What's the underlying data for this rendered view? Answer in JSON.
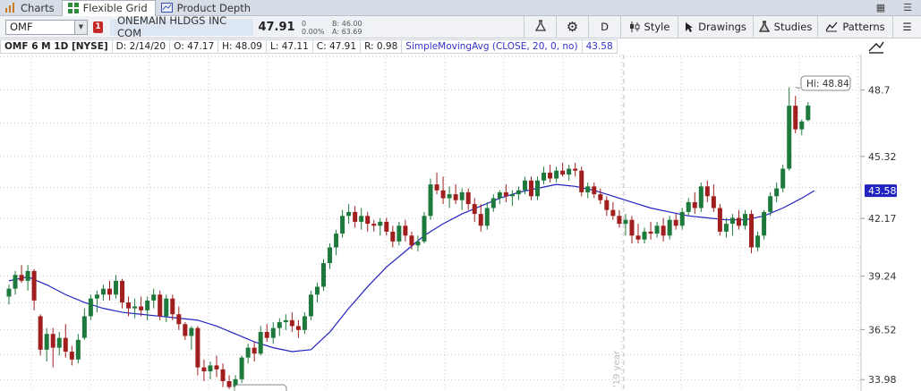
{
  "tabs": [
    {
      "label": "Charts",
      "icon": "bar-chart-icon",
      "active": false
    },
    {
      "label": "Flexible Grid",
      "icon": "grid-icon",
      "active": true
    },
    {
      "label": "Product Depth",
      "icon": "depth-icon",
      "active": false
    }
  ],
  "toolbar": {
    "symbol": "OMF",
    "badge": "1",
    "company": "ONEMAIN HLDGS INC COM",
    "last": "47.91",
    "change": "0",
    "change_pct": "0.00%",
    "bid": "B: 46.00",
    "ask": "A: 63.69",
    "aggregation": "D",
    "style_label": "Style",
    "drawings_label": "Drawings",
    "studies_label": "Studies",
    "patterns_label": "Patterns"
  },
  "info": {
    "title": "OMF 6 M 1D [NYSE]",
    "date": "D: 2/14/20",
    "open": "O: 47.17",
    "high": "H: 48.09",
    "low": "L: 47.11",
    "close": "C: 47.91",
    "range": "R: 0.98",
    "study": "SimpleMovingAvg (CLOSE, 20, 0, no)",
    "study_value": "43.58"
  },
  "chart_data": {
    "type": "candlestick",
    "y_ticks": [
      33.98,
      36.52,
      39.24,
      42.17,
      45.32,
      48.7
    ],
    "ylim": [
      33.4,
      50.5
    ],
    "hi_label": "Hi: 48.84",
    "study_value_label": "43.58",
    "year_label": "'19 year",
    "up_color": "#1e7a3c",
    "down_color": "#a01e1e",
    "sma_color": "#2323c0",
    "candles": [
      [
        38.2,
        38.8,
        37.8,
        38.6
      ],
      [
        38.6,
        39.5,
        38.3,
        39.3
      ],
      [
        39.3,
        39.8,
        38.9,
        39.0
      ],
      [
        39.0,
        39.8,
        38.5,
        39.5
      ],
      [
        39.5,
        39.6,
        37.5,
        38.0
      ],
      [
        37.2,
        37.3,
        35.2,
        35.5
      ],
      [
        35.5,
        36.6,
        34.9,
        36.3
      ],
      [
        36.3,
        36.6,
        34.6,
        35.6
      ],
      [
        35.6,
        36.4,
        35.2,
        36.1
      ],
      [
        36.1,
        36.8,
        35.1,
        35.4
      ],
      [
        35.4,
        35.7,
        34.7,
        35.0
      ],
      [
        35.0,
        36.3,
        34.8,
        36.0
      ],
      [
        36.1,
        37.6,
        36.0,
        37.2
      ],
      [
        37.2,
        38.3,
        37.0,
        38.1
      ],
      [
        38.1,
        38.5,
        37.4,
        38.3
      ],
      [
        38.3,
        38.8,
        38.0,
        38.6
      ],
      [
        38.6,
        39.0,
        38.0,
        38.3
      ],
      [
        38.3,
        39.3,
        38.1,
        39.0
      ],
      [
        39.0,
        39.1,
        37.6,
        37.9
      ],
      [
        37.9,
        38.2,
        37.2,
        37.6
      ],
      [
        37.6,
        38.1,
        37.1,
        37.7
      ],
      [
        37.7,
        38.2,
        37.2,
        37.5
      ],
      [
        37.5,
        38.2,
        37.0,
        38.0
      ],
      [
        38.0,
        38.6,
        37.6,
        38.3
      ],
      [
        38.3,
        38.5,
        37.0,
        37.2
      ],
      [
        37.2,
        38.3,
        36.9,
        38.1
      ],
      [
        38.1,
        38.3,
        37.0,
        37.3
      ],
      [
        37.3,
        37.7,
        36.5,
        36.8
      ],
      [
        36.8,
        36.9,
        36.0,
        36.2
      ],
      [
        36.2,
        36.7,
        35.5,
        36.6
      ],
      [
        36.6,
        36.7,
        34.2,
        34.6
      ],
      [
        34.6,
        35.0,
        33.9,
        34.4
      ],
      [
        34.4,
        34.9,
        34.0,
        34.7
      ],
      [
        34.7,
        35.2,
        34.1,
        34.5
      ],
      [
        34.5,
        34.8,
        33.6,
        33.9
      ],
      [
        33.9,
        34.2,
        33.5,
        33.6
      ],
      [
        33.6,
        34.2,
        33.4,
        34.0
      ],
      [
        34.0,
        35.2,
        33.8,
        35.1
      ],
      [
        35.1,
        35.8,
        34.8,
        35.6
      ],
      [
        35.6,
        35.9,
        34.9,
        35.3
      ],
      [
        35.3,
        36.7,
        35.2,
        36.4
      ],
      [
        36.4,
        36.8,
        35.9,
        36.1
      ],
      [
        36.1,
        36.9,
        35.8,
        36.6
      ],
      [
        36.6,
        37.1,
        36.2,
        36.9
      ],
      [
        36.9,
        37.3,
        36.5,
        37.0
      ],
      [
        37.0,
        37.4,
        36.4,
        36.7
      ],
      [
        36.7,
        37.0,
        36.1,
        36.5
      ],
      [
        36.5,
        37.4,
        36.3,
        37.2
      ],
      [
        37.2,
        38.5,
        37.0,
        38.3
      ],
      [
        38.3,
        38.9,
        37.9,
        38.7
      ],
      [
        38.7,
        40.1,
        38.5,
        39.9
      ],
      [
        39.9,
        40.9,
        39.6,
        40.7
      ],
      [
        40.7,
        41.6,
        40.3,
        41.4
      ],
      [
        41.4,
        42.6,
        41.2,
        42.3
      ],
      [
        42.3,
        42.9,
        41.9,
        42.5
      ],
      [
        42.5,
        42.8,
        41.7,
        42.0
      ],
      [
        42.0,
        42.7,
        41.6,
        42.3
      ],
      [
        42.3,
        42.5,
        41.5,
        41.9
      ],
      [
        41.9,
        42.1,
        41.5,
        41.8
      ],
      [
        41.8,
        42.2,
        41.3,
        42.0
      ],
      [
        42.0,
        42.2,
        41.3,
        41.5
      ],
      [
        41.5,
        41.8,
        40.7,
        41.0
      ],
      [
        41.0,
        42.0,
        40.8,
        41.8
      ],
      [
        41.8,
        42.1,
        41.0,
        41.3
      ],
      [
        41.3,
        41.5,
        40.6,
        40.8
      ],
      [
        40.8,
        41.3,
        40.5,
        41.0
      ],
      [
        41.0,
        42.5,
        40.9,
        42.3
      ],
      [
        42.3,
        44.2,
        42.1,
        43.9
      ],
      [
        43.9,
        44.5,
        43.4,
        43.6
      ],
      [
        43.6,
        44.3,
        42.9,
        43.2
      ],
      [
        43.2,
        43.8,
        42.7,
        43.4
      ],
      [
        43.4,
        43.9,
        42.9,
        43.1
      ],
      [
        43.1,
        43.7,
        42.6,
        43.5
      ],
      [
        43.5,
        43.7,
        42.6,
        42.9
      ],
      [
        42.9,
        43.2,
        42.0,
        42.4
      ],
      [
        42.4,
        42.9,
        41.5,
        41.8
      ],
      [
        41.8,
        43.0,
        41.6,
        42.7
      ],
      [
        42.7,
        43.4,
        42.5,
        43.2
      ],
      [
        43.2,
        43.6,
        42.9,
        43.5
      ],
      [
        43.5,
        43.9,
        43.0,
        43.3
      ],
      [
        43.3,
        43.6,
        42.8,
        43.4
      ],
      [
        43.4,
        43.8,
        43.1,
        43.6
      ],
      [
        43.6,
        44.3,
        43.4,
        44.1
      ],
      [
        44.1,
        44.3,
        43.1,
        43.3
      ],
      [
        43.3,
        44.3,
        43.1,
        44.1
      ],
      [
        44.1,
        44.8,
        43.9,
        44.5
      ],
      [
        44.5,
        44.9,
        44.0,
        44.2
      ],
      [
        44.2,
        44.8,
        44.0,
        44.6
      ],
      [
        44.6,
        45.0,
        44.3,
        44.4
      ],
      [
        44.4,
        44.9,
        44.1,
        44.7
      ],
      [
        44.7,
        45.0,
        44.3,
        44.6
      ],
      [
        44.6,
        44.8,
        43.3,
        43.5
      ],
      [
        43.5,
        44.0,
        43.2,
        43.8
      ],
      [
        43.8,
        44.0,
        43.2,
        43.4
      ],
      [
        43.4,
        43.7,
        42.9,
        43.1
      ],
      [
        43.1,
        43.3,
        42.3,
        42.6
      ],
      [
        42.6,
        43.0,
        42.1,
        42.3
      ],
      [
        42.3,
        42.6,
        41.7,
        41.9
      ],
      [
        41.9,
        42.4,
        41.3,
        42.1
      ],
      [
        42.1,
        42.3,
        40.9,
        41.3
      ],
      [
        41.3,
        41.9,
        40.9,
        41.1
      ],
      [
        41.1,
        41.7,
        40.9,
        41.5
      ],
      [
        41.5,
        42.0,
        41.1,
        41.4
      ],
      [
        41.4,
        42.0,
        41.2,
        41.8
      ],
      [
        41.8,
        42.2,
        41.0,
        41.3
      ],
      [
        41.3,
        42.3,
        41.1,
        42.1
      ],
      [
        42.1,
        42.4,
        41.6,
        41.8
      ],
      [
        41.8,
        42.7,
        41.6,
        42.5
      ],
      [
        42.5,
        43.2,
        42.3,
        43.0
      ],
      [
        43.0,
        43.5,
        42.4,
        42.7
      ],
      [
        42.7,
        44.0,
        42.5,
        43.8
      ],
      [
        43.8,
        44.1,
        43.0,
        43.3
      ],
      [
        43.3,
        43.9,
        42.5,
        42.7
      ],
      [
        42.7,
        42.9,
        41.3,
        41.5
      ],
      [
        41.5,
        42.2,
        41.2,
        41.9
      ],
      [
        41.9,
        42.4,
        41.3,
        42.2
      ],
      [
        42.2,
        42.6,
        41.6,
        41.8
      ],
      [
        41.8,
        42.6,
        41.6,
        42.4
      ],
      [
        42.4,
        42.6,
        40.4,
        40.7
      ],
      [
        40.7,
        41.5,
        40.5,
        41.3
      ],
      [
        41.3,
        42.6,
        41.1,
        42.5
      ],
      [
        42.5,
        43.5,
        42.3,
        43.3
      ],
      [
        43.3,
        44.0,
        43.0,
        43.7
      ],
      [
        43.7,
        44.9,
        43.5,
        44.7
      ],
      [
        44.7,
        48.84,
        44.6,
        47.9
      ],
      [
        47.9,
        48.4,
        46.5,
        46.7
      ],
      [
        46.7,
        47.2,
        46.4,
        47.1
      ],
      [
        47.17,
        48.09,
        47.11,
        47.91
      ]
    ],
    "sma": [
      [
        0,
        39.0
      ],
      [
        3,
        39.2
      ],
      [
        6,
        38.8
      ],
      [
        9,
        38.3
      ],
      [
        12,
        37.9
      ],
      [
        15,
        37.6
      ],
      [
        18,
        37.4
      ],
      [
        21,
        37.3
      ],
      [
        24,
        37.2
      ],
      [
        27,
        37.1
      ],
      [
        30,
        37.0
      ],
      [
        33,
        36.7
      ],
      [
        36,
        36.3
      ],
      [
        39,
        35.9
      ],
      [
        42,
        35.6
      ],
      [
        45,
        35.4
      ],
      [
        48,
        35.5
      ],
      [
        51,
        36.4
      ],
      [
        54,
        37.6
      ],
      [
        57,
        38.7
      ],
      [
        60,
        39.7
      ],
      [
        63,
        40.5
      ],
      [
        66,
        41.3
      ],
      [
        69,
        41.9
      ],
      [
        72,
        42.4
      ],
      [
        75,
        42.8
      ],
      [
        78,
        43.2
      ],
      [
        81,
        43.5
      ],
      [
        84,
        43.7
      ],
      [
        87,
        43.9
      ],
      [
        90,
        43.8
      ],
      [
        93,
        43.6
      ],
      [
        96,
        43.3
      ],
      [
        99,
        43.0
      ],
      [
        102,
        42.7
      ],
      [
        105,
        42.5
      ],
      [
        108,
        42.3
      ],
      [
        111,
        42.2
      ],
      [
        114,
        42.1
      ],
      [
        117,
        42.1
      ],
      [
        120,
        42.3
      ],
      [
        123,
        42.7
      ],
      [
        126,
        43.2
      ],
      [
        128,
        43.58
      ]
    ]
  }
}
